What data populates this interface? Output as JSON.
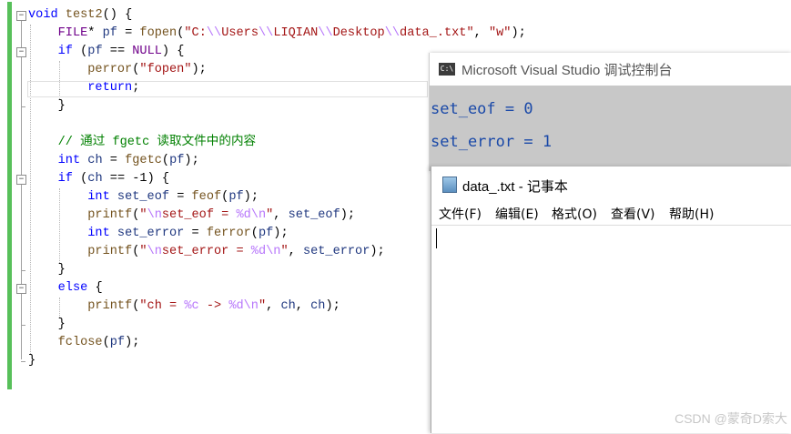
{
  "editor": {
    "lines": [
      [
        [
          "void",
          "kw"
        ],
        [
          " ",
          ""
        ],
        [
          "test2",
          "fn"
        ],
        [
          "() {",
          ""
        ]
      ],
      [
        [
          "    ",
          ""
        ],
        [
          "FILE",
          "mac"
        ],
        [
          "* ",
          ""
        ],
        [
          "pf",
          "var"
        ],
        [
          " = ",
          ""
        ],
        [
          "fopen",
          "fn"
        ],
        [
          "(",
          ""
        ],
        [
          "\"C:",
          "str"
        ],
        [
          "\\\\",
          "esc"
        ],
        [
          "Users",
          "str"
        ],
        [
          "\\\\",
          "esc"
        ],
        [
          "LIQIAN",
          "str"
        ],
        [
          "\\\\",
          "esc"
        ],
        [
          "Desktop",
          "str"
        ],
        [
          "\\\\",
          "esc"
        ],
        [
          "data_.txt\"",
          "str"
        ],
        [
          ", ",
          ""
        ],
        [
          "\"w\"",
          "str"
        ],
        [
          ");",
          ""
        ]
      ],
      [
        [
          "    ",
          ""
        ],
        [
          "if",
          "kw"
        ],
        [
          " (",
          ""
        ],
        [
          "pf",
          "var"
        ],
        [
          " == ",
          ""
        ],
        [
          "NULL",
          "mac"
        ],
        [
          ") {",
          ""
        ]
      ],
      [
        [
          "        ",
          ""
        ],
        [
          "perror",
          "fn"
        ],
        [
          "(",
          ""
        ],
        [
          "\"fopen\"",
          "str"
        ],
        [
          ");",
          ""
        ]
      ],
      [
        [
          "        ",
          ""
        ],
        [
          "return",
          "kw"
        ],
        [
          ";",
          ""
        ]
      ],
      [
        [
          "    }",
          ""
        ]
      ],
      [
        [
          "",
          ""
        ]
      ],
      [
        [
          "    ",
          ""
        ],
        [
          "// 通过 fgetc 读取文件中的内容",
          "cm"
        ]
      ],
      [
        [
          "    ",
          ""
        ],
        [
          "int",
          "kw"
        ],
        [
          " ",
          ""
        ],
        [
          "ch",
          "var"
        ],
        [
          " = ",
          ""
        ],
        [
          "fgetc",
          "fn"
        ],
        [
          "(",
          ""
        ],
        [
          "pf",
          "var"
        ],
        [
          ");",
          ""
        ]
      ],
      [
        [
          "    ",
          ""
        ],
        [
          "if",
          "kw"
        ],
        [
          " (",
          ""
        ],
        [
          "ch",
          "var"
        ],
        [
          " == -1) {",
          ""
        ]
      ],
      [
        [
          "        ",
          ""
        ],
        [
          "int",
          "kw"
        ],
        [
          " ",
          ""
        ],
        [
          "set_eof",
          "var"
        ],
        [
          " = ",
          ""
        ],
        [
          "feof",
          "fn"
        ],
        [
          "(",
          ""
        ],
        [
          "pf",
          "var"
        ],
        [
          ");",
          ""
        ]
      ],
      [
        [
          "        ",
          ""
        ],
        [
          "printf",
          "fn"
        ],
        [
          "(",
          ""
        ],
        [
          "\"",
          "str"
        ],
        [
          "\\n",
          "esc"
        ],
        [
          "set_eof = ",
          "str"
        ],
        [
          "%d",
          "esc"
        ],
        [
          "\\n",
          "esc"
        ],
        [
          "\"",
          "str"
        ],
        [
          ", ",
          ""
        ],
        [
          "set_eof",
          "var"
        ],
        [
          ");",
          ""
        ]
      ],
      [
        [
          "        ",
          ""
        ],
        [
          "int",
          "kw"
        ],
        [
          " ",
          ""
        ],
        [
          "set_error",
          "var"
        ],
        [
          " = ",
          ""
        ],
        [
          "ferror",
          "fn"
        ],
        [
          "(",
          ""
        ],
        [
          "pf",
          "var"
        ],
        [
          ");",
          ""
        ]
      ],
      [
        [
          "        ",
          ""
        ],
        [
          "printf",
          "fn"
        ],
        [
          "(",
          ""
        ],
        [
          "\"",
          "str"
        ],
        [
          "\\n",
          "esc"
        ],
        [
          "set_error = ",
          "str"
        ],
        [
          "%d",
          "esc"
        ],
        [
          "\\n",
          "esc"
        ],
        [
          "\"",
          "str"
        ],
        [
          ", ",
          ""
        ],
        [
          "set_error",
          "var"
        ],
        [
          ");",
          ""
        ]
      ],
      [
        [
          "    }",
          ""
        ]
      ],
      [
        [
          "    ",
          ""
        ],
        [
          "else",
          "kw"
        ],
        [
          " {",
          ""
        ]
      ],
      [
        [
          "        ",
          ""
        ],
        [
          "printf",
          "fn"
        ],
        [
          "(",
          ""
        ],
        [
          "\"ch = ",
          "str"
        ],
        [
          "%c",
          "esc"
        ],
        [
          " -> ",
          "str"
        ],
        [
          "%d",
          "esc"
        ],
        [
          "\\n",
          "esc"
        ],
        [
          "\"",
          "str"
        ],
        [
          ", ",
          ""
        ],
        [
          "ch",
          "var"
        ],
        [
          ", ",
          ""
        ],
        [
          "ch",
          "var"
        ],
        [
          ");",
          ""
        ]
      ],
      [
        [
          "    }",
          ""
        ]
      ],
      [
        [
          "    ",
          ""
        ],
        [
          "fclose",
          "fn"
        ],
        [
          "(",
          ""
        ],
        [
          "pf",
          "var"
        ],
        [
          ");",
          ""
        ]
      ],
      [
        [
          "}",
          ""
        ]
      ]
    ]
  },
  "console": {
    "icon_label": "C:\\",
    "title": "Microsoft Visual Studio 调试控制台",
    "output": [
      "set_eof = 0",
      "set_error = 1"
    ]
  },
  "notepad": {
    "title": "data_.txt - 记事本",
    "menu": [
      "文件(F)",
      "编辑(E)",
      "格式(O)",
      "查看(V)",
      "帮助(H)"
    ],
    "content": ""
  },
  "watermark": "CSDN @蒙奇D索大"
}
